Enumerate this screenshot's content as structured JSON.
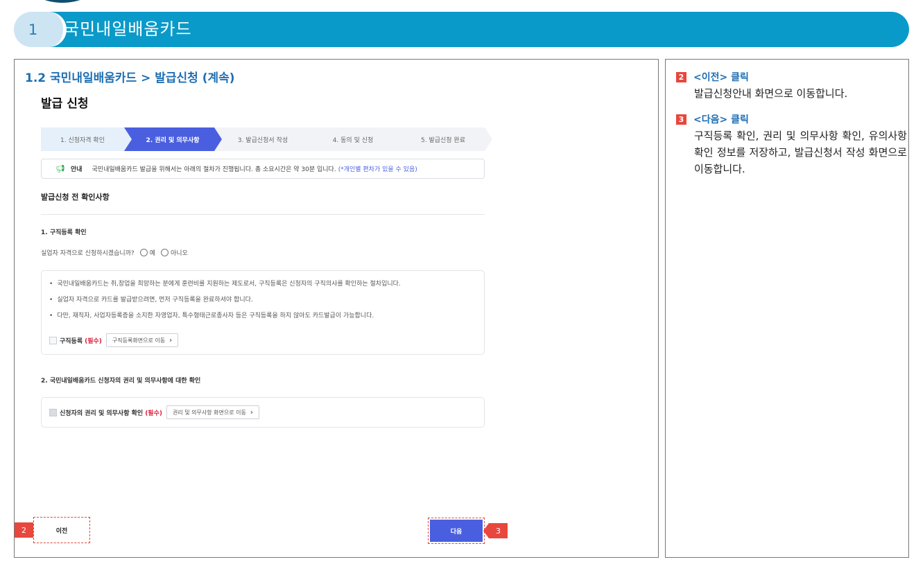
{
  "banner": {
    "number": "1",
    "title": "국민내일배움카드"
  },
  "main": {
    "section_title": "1.2 국민내일배움카드 > 발급신청 (계속)",
    "page_title": "발급 신청",
    "steps": [
      {
        "label": "1. 신청자격 확인"
      },
      {
        "label": "2. 권리 및 의무사항"
      },
      {
        "label": "3. 발급신청서 작성"
      },
      {
        "label": "4. 동의 및 신청"
      },
      {
        "label": "5. 발급신청 완료"
      }
    ],
    "notice": {
      "label": "안내",
      "text": "국민내일배움카드 발급을 위해서는 아래의 절차가 진행됩니다. 총 소요시간은 약 30분 입니다.",
      "emphasis": "(*개인별 편차가 있을 수 있음)"
    },
    "sub_heading": "발급신청 전 확인사항",
    "q1": {
      "title": "1. 구직등록 확인",
      "question": "실업자 자격으로 신청하시겠습니까?",
      "option_yes": "예",
      "option_no": "아니오",
      "bullets": [
        "국민내일배움카드는 취,창업을 희망하는 분에게 훈련비를 지원하는 제도로서, 구직등록은 신청자의 구직의사를 확인하는 절차입니다.",
        "실업자 자격으로 카드를 발급받으려면, 먼저 구직등록을 완료하셔야 합니다.",
        "다만, 재직자, 사업자등록증을 소지한 자영업자, 특수형태근로종사자 등은 구직등록을 하지 않아도 카드발급이 가능합니다."
      ],
      "check_label": "구직등록",
      "required": "(필수)",
      "link": "구직등록화면으로 이동"
    },
    "q2": {
      "title": "2. 국민내일배움카드 신청자의 권리 및 의무사항에 대한 확인",
      "check_label": "신청자의 권리 및 의무사항 확인",
      "required": "(필수)",
      "link": "권리 및 의무사항 화면으로 이동"
    },
    "prev_button": "이전",
    "next_button": "다음",
    "callout_prev": "2",
    "callout_next": "3"
  },
  "notes": [
    {
      "badge": "2",
      "title": "<이전> 클릭",
      "body": "발급신청안내 화면으로 이동합니다."
    },
    {
      "badge": "3",
      "title": "<다음> 클릭",
      "body": "구직등록 확인, 권리 및 의무사항 확인, 유의사항 확인 정보를 저장하고, 발급신청서 작성 화면으로 이동합니다."
    }
  ],
  "colors": {
    "banner_blue": "#0a9ac9",
    "title_blue": "#1e6fb3",
    "step_active": "#4a5fe0",
    "callout_red": "#e8473d",
    "required_red": "#d8203a"
  }
}
